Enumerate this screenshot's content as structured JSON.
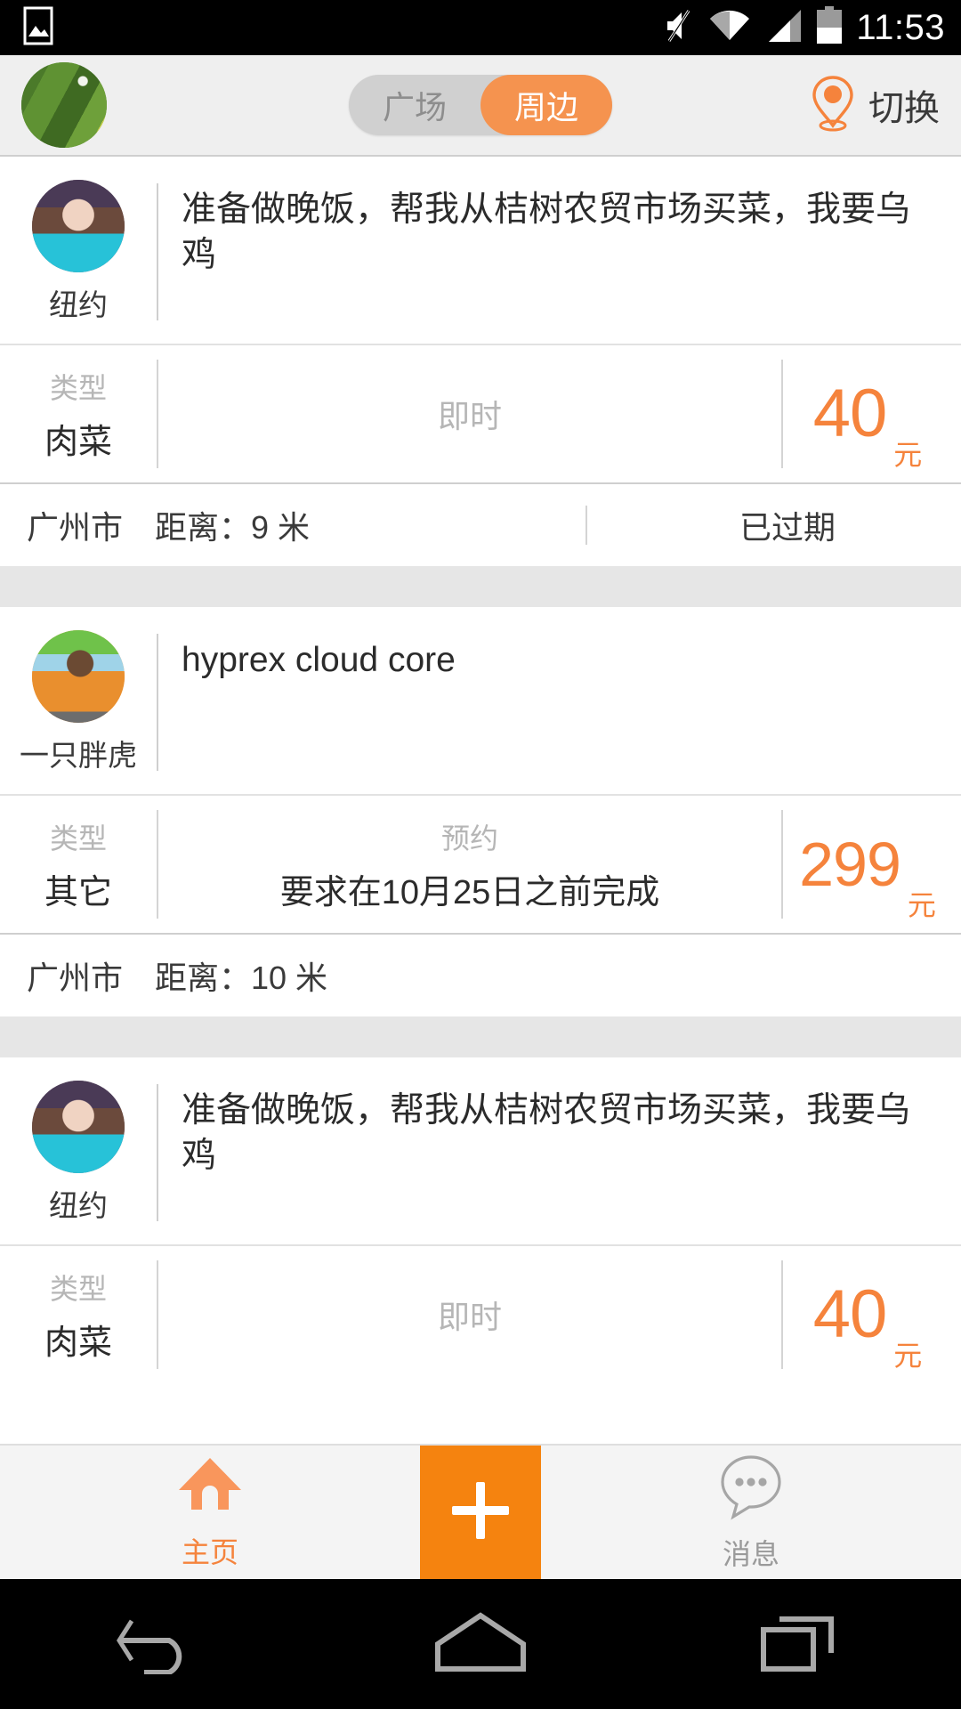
{
  "statusbar": {
    "clock": "11:53",
    "icons": [
      "image-icon",
      "mute-icon",
      "wifi-icon",
      "cellular-signal-icon",
      "battery-icon"
    ]
  },
  "header": {
    "avatar_name": "user-avatar",
    "segment": {
      "options": [
        {
          "label": "广场",
          "active": false
        },
        {
          "label": "周边",
          "active": true
        }
      ]
    },
    "switch": {
      "icon": "location-pin-icon",
      "label": "切换"
    }
  },
  "theme": {
    "accent": "#f5833c",
    "accent_strong": "#f5830f",
    "segment_active": "#f5934f",
    "segment_track": "#d0d0d0",
    "header_bg": "#efefef",
    "gap_bg": "#e6e6e6",
    "divider": "#cfcfcf",
    "muted_text": "#b6b6b6",
    "body_text": "#2b2b2b"
  },
  "list": {
    "cards": [
      {
        "poster": {
          "name": "纽约",
          "avatar": "girl-avatar"
        },
        "title": "准备做晚饭，帮我从桔树农贸市场买菜，我要乌鸡",
        "meta": {
          "type_caption": "类型",
          "type_value": "肉菜",
          "time_caption": "即时",
          "time_value": "",
          "price": "40",
          "price_unit": "元"
        },
        "location": {
          "city": "广州市",
          "distance": "距离：9 米",
          "status": "已过期"
        }
      },
      {
        "poster": {
          "name": "一只胖虎",
          "avatar": "tiger-avatar"
        },
        "title": "hyprex cloud core",
        "meta": {
          "type_caption": "类型",
          "type_value": "其它",
          "time_caption": "预约",
          "time_value": "要求在10月25日之前完成",
          "price": "299",
          "price_unit": "元"
        },
        "location": {
          "city": "广州市",
          "distance": "距离：10 米",
          "status": ""
        }
      },
      {
        "poster": {
          "name": "纽约",
          "avatar": "girl-avatar"
        },
        "title": "准备做晚饭，帮我从桔树农贸市场买菜，我要乌鸡",
        "meta": {
          "type_caption": "类型",
          "type_value": "肉菜",
          "time_caption": "即时",
          "time_value": "",
          "price": "40",
          "price_unit": "元"
        },
        "location": {
          "city": "",
          "distance": "",
          "status": ""
        }
      }
    ]
  },
  "tabbar": {
    "home": {
      "label": "主页",
      "icon": "home-icon",
      "active": true
    },
    "plus": {
      "label": "",
      "icon": "plus-icon"
    },
    "messages": {
      "label": "消息",
      "icon": "chat-bubble-icon",
      "active": false
    }
  },
  "navbar": {
    "back": "back-icon",
    "home": "home-icon",
    "recents": "recents-icon"
  }
}
